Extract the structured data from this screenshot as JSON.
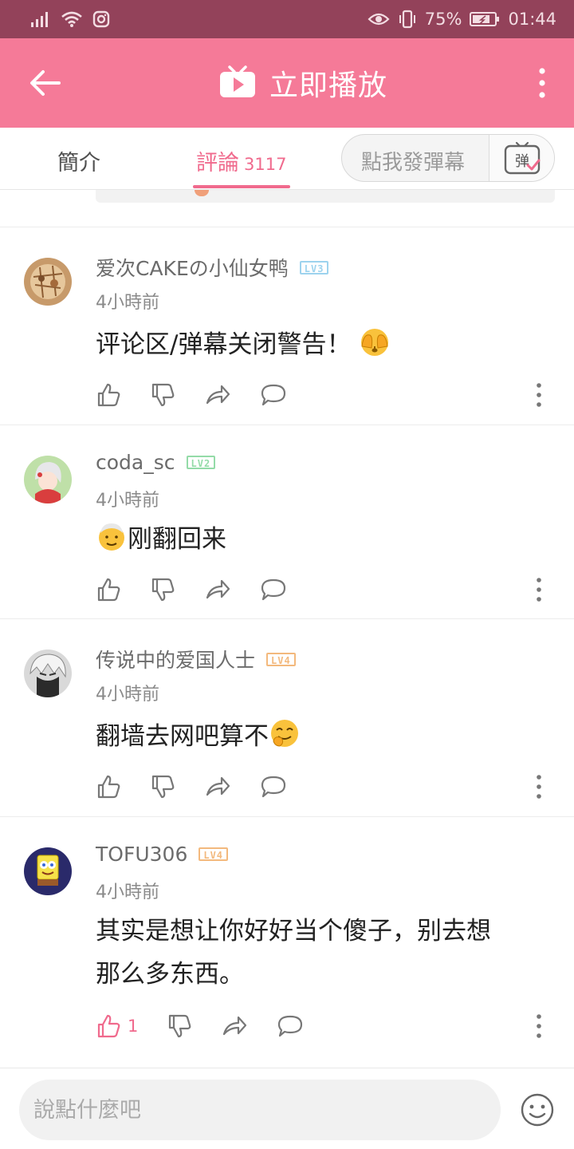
{
  "status_bar": {
    "battery_percent": "75%",
    "time": "01:44"
  },
  "app_bar": {
    "title": "立即播放"
  },
  "tabs": {
    "intro_label": "簡介",
    "comments_label": "評論",
    "comments_count": "3117"
  },
  "danmaku": {
    "button_label": "點我發彈幕",
    "icon_char": "弹"
  },
  "comments": [
    {
      "username": "爱次CAKEの小仙女鸭",
      "level": "LV3",
      "time": "4小時前",
      "text": "评论区/弹幕关闭警告！",
      "emoji": "hands-over-eyes-emoji",
      "likes": ""
    },
    {
      "username": "coda_sc",
      "level": "LV2",
      "time": "4小時前",
      "text": "刚翻回来",
      "emoji": "old-man-emoji",
      "likes": ""
    },
    {
      "username": "传说中的爱国人士",
      "level": "LV4",
      "time": "4小時前",
      "text": "翻墙去网吧算不",
      "emoji": "giggle-emoji",
      "likes": ""
    },
    {
      "username": "TOFU306",
      "level": "LV4",
      "time": "4小時前",
      "text_line1": "其实是想让你好好当个傻子，别去想",
      "text_line2": "那么多东西。",
      "likes": "1"
    }
  ],
  "input": {
    "placeholder": "說點什麼吧"
  },
  "colors": {
    "status_bar": "#93425a",
    "app_bar": "#f57a98",
    "accent": "#f06a8d"
  }
}
